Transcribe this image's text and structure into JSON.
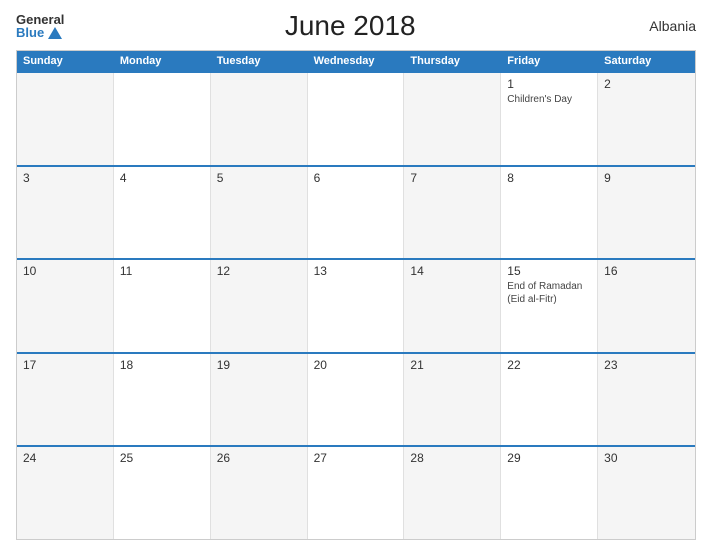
{
  "header": {
    "logo_general": "General",
    "logo_blue": "Blue",
    "title": "June 2018",
    "country": "Albania"
  },
  "calendar": {
    "days_of_week": [
      "Sunday",
      "Monday",
      "Tuesday",
      "Wednesday",
      "Thursday",
      "Friday",
      "Saturday"
    ],
    "weeks": [
      [
        {
          "day": "",
          "holiday": ""
        },
        {
          "day": "",
          "holiday": ""
        },
        {
          "day": "",
          "holiday": ""
        },
        {
          "day": "",
          "holiday": ""
        },
        {
          "day": "",
          "holiday": ""
        },
        {
          "day": "1",
          "holiday": "Children's Day"
        },
        {
          "day": "2",
          "holiday": ""
        }
      ],
      [
        {
          "day": "3",
          "holiday": ""
        },
        {
          "day": "4",
          "holiday": ""
        },
        {
          "day": "5",
          "holiday": ""
        },
        {
          "day": "6",
          "holiday": ""
        },
        {
          "day": "7",
          "holiday": ""
        },
        {
          "day": "8",
          "holiday": ""
        },
        {
          "day": "9",
          "holiday": ""
        }
      ],
      [
        {
          "day": "10",
          "holiday": ""
        },
        {
          "day": "11",
          "holiday": ""
        },
        {
          "day": "12",
          "holiday": ""
        },
        {
          "day": "13",
          "holiday": ""
        },
        {
          "day": "14",
          "holiday": ""
        },
        {
          "day": "15",
          "holiday": "End of Ramadan (Eid al-Fitr)"
        },
        {
          "day": "16",
          "holiday": ""
        }
      ],
      [
        {
          "day": "17",
          "holiday": ""
        },
        {
          "day": "18",
          "holiday": ""
        },
        {
          "day": "19",
          "holiday": ""
        },
        {
          "day": "20",
          "holiday": ""
        },
        {
          "day": "21",
          "holiday": ""
        },
        {
          "day": "22",
          "holiday": ""
        },
        {
          "day": "23",
          "holiday": ""
        }
      ],
      [
        {
          "day": "24",
          "holiday": ""
        },
        {
          "day": "25",
          "holiday": ""
        },
        {
          "day": "26",
          "holiday": ""
        },
        {
          "day": "27",
          "holiday": ""
        },
        {
          "day": "28",
          "holiday": ""
        },
        {
          "day": "29",
          "holiday": ""
        },
        {
          "day": "30",
          "holiday": ""
        }
      ]
    ]
  }
}
